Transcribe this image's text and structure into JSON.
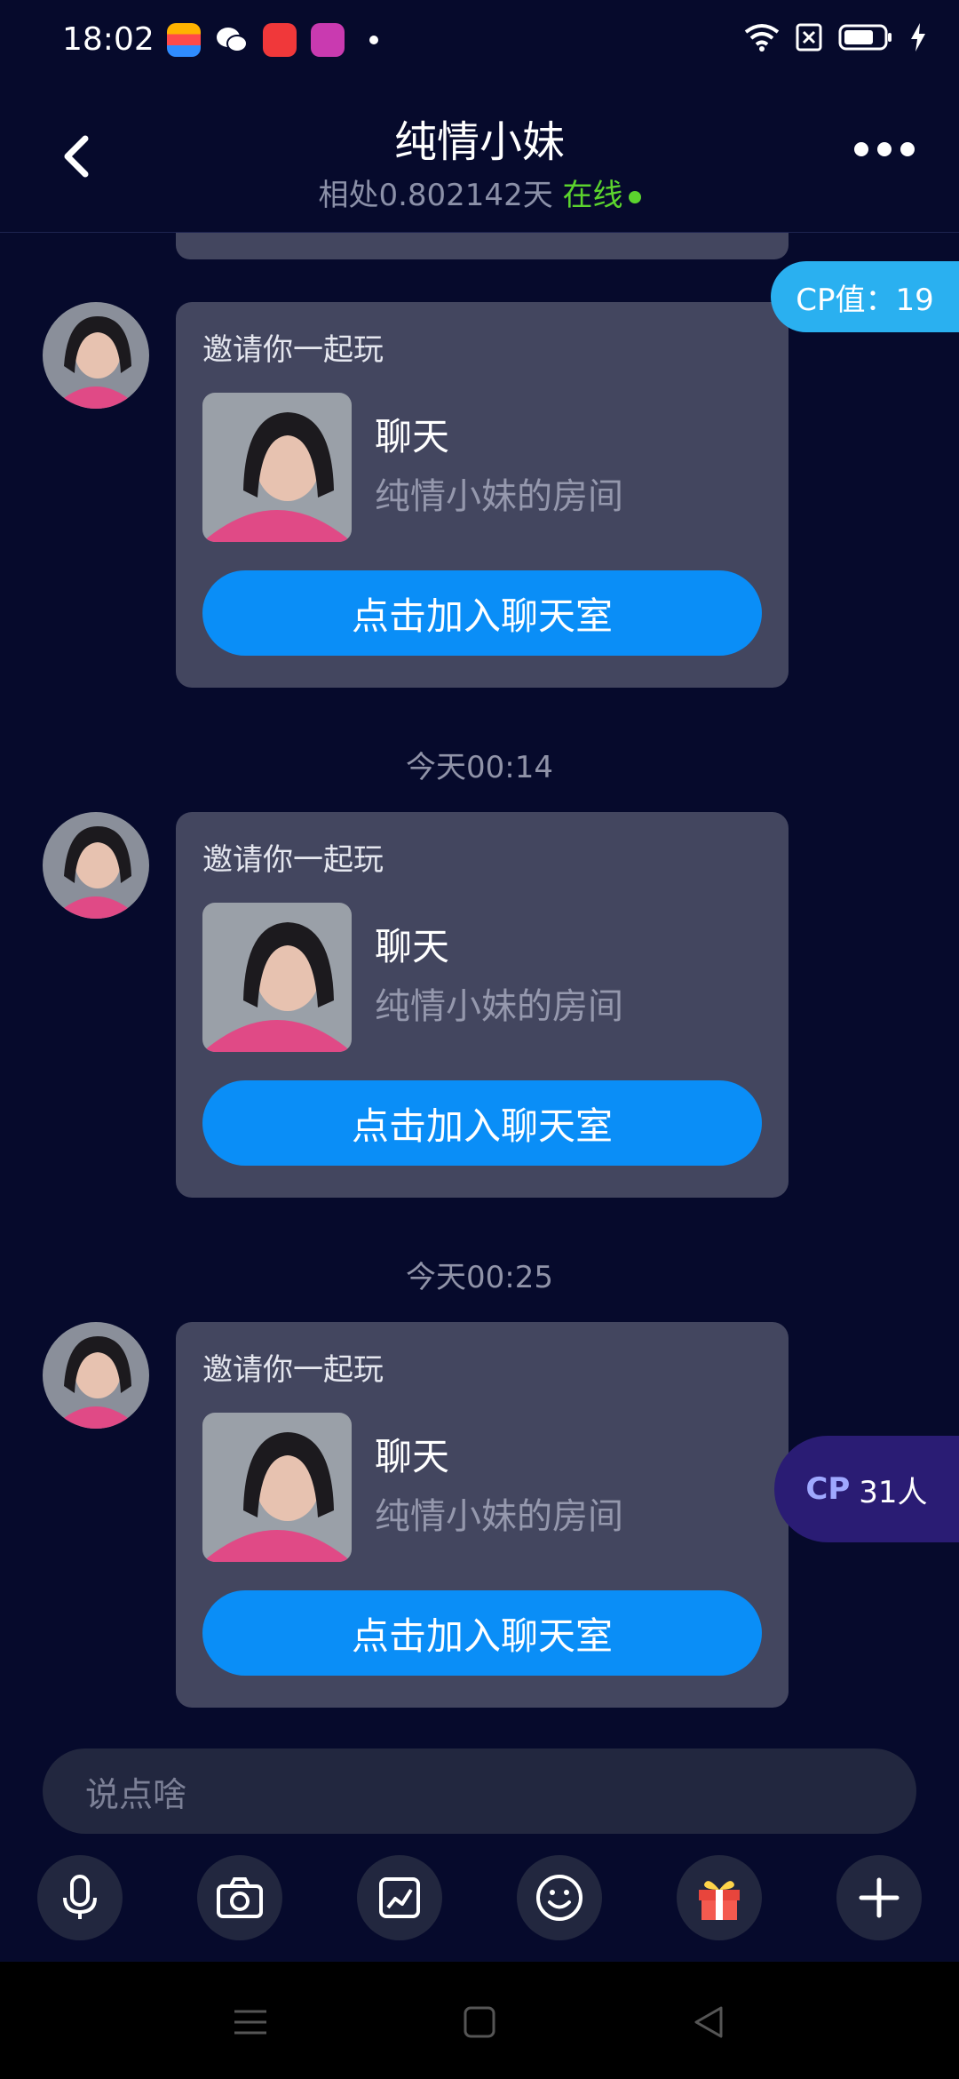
{
  "status_bar": {
    "time": "18:02"
  },
  "header": {
    "title": "纯情小妹",
    "days_together": "相处0.802142天",
    "online_status": "在线"
  },
  "cp_badge": {
    "label": "CP值：19"
  },
  "cp_people": {
    "prefix": "CP",
    "count": "31人"
  },
  "messages": [
    {
      "label": "邀请你一起玩",
      "name": "聊天",
      "room": "纯情小妹的房间",
      "button": "点击加入聊天室"
    },
    {
      "timestamp": "今天00:14",
      "label": "邀请你一起玩",
      "name": "聊天",
      "room": "纯情小妹的房间",
      "button": "点击加入聊天室"
    },
    {
      "timestamp": "今天00:25",
      "label": "邀请你一起玩",
      "name": "聊天",
      "room": "纯情小妹的房间",
      "button": "点击加入聊天室"
    }
  ],
  "input": {
    "placeholder": "说点啥"
  },
  "toolbar_icons": [
    "microphone-icon",
    "camera-icon",
    "image-icon",
    "emoji-icon",
    "gift-icon",
    "plus-icon"
  ],
  "colors": {
    "background": "#060a2c",
    "card": "#43465f",
    "accent": "#0a8ef7",
    "online": "#5cd42e",
    "cp_badge": "#2ab0f0",
    "cp_people": "#2a1c74"
  }
}
